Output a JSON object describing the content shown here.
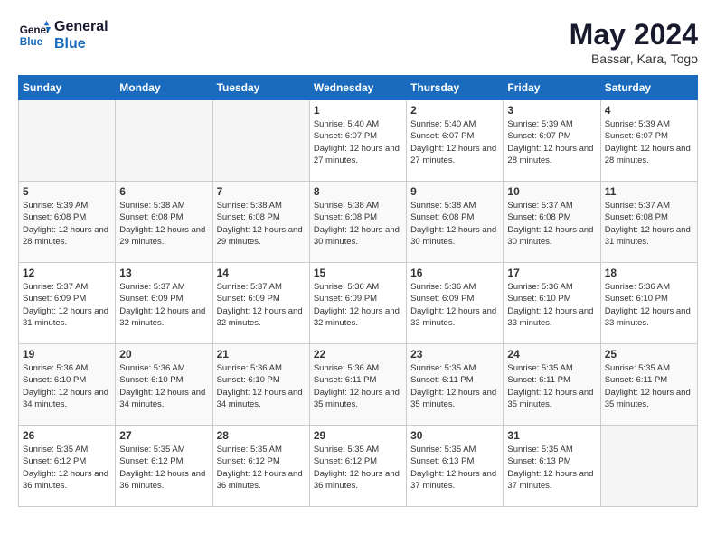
{
  "header": {
    "logo_line1": "General",
    "logo_line2": "Blue",
    "month_title": "May 2024",
    "subtitle": "Bassar, Kara, Togo"
  },
  "days_of_week": [
    "Sunday",
    "Monday",
    "Tuesday",
    "Wednesday",
    "Thursday",
    "Friday",
    "Saturday"
  ],
  "weeks": [
    [
      {
        "day": "",
        "empty": true
      },
      {
        "day": "",
        "empty": true
      },
      {
        "day": "",
        "empty": true
      },
      {
        "day": "1",
        "sunrise": "5:40 AM",
        "sunset": "6:07 PM",
        "daylight": "12 hours and 27 minutes."
      },
      {
        "day": "2",
        "sunrise": "5:40 AM",
        "sunset": "6:07 PM",
        "daylight": "12 hours and 27 minutes."
      },
      {
        "day": "3",
        "sunrise": "5:39 AM",
        "sunset": "6:07 PM",
        "daylight": "12 hours and 28 minutes."
      },
      {
        "day": "4",
        "sunrise": "5:39 AM",
        "sunset": "6:07 PM",
        "daylight": "12 hours and 28 minutes."
      }
    ],
    [
      {
        "day": "5",
        "sunrise": "5:39 AM",
        "sunset": "6:08 PM",
        "daylight": "12 hours and 28 minutes."
      },
      {
        "day": "6",
        "sunrise": "5:38 AM",
        "sunset": "6:08 PM",
        "daylight": "12 hours and 29 minutes."
      },
      {
        "day": "7",
        "sunrise": "5:38 AM",
        "sunset": "6:08 PM",
        "daylight": "12 hours and 29 minutes."
      },
      {
        "day": "8",
        "sunrise": "5:38 AM",
        "sunset": "6:08 PM",
        "daylight": "12 hours and 30 minutes."
      },
      {
        "day": "9",
        "sunrise": "5:38 AM",
        "sunset": "6:08 PM",
        "daylight": "12 hours and 30 minutes."
      },
      {
        "day": "10",
        "sunrise": "5:37 AM",
        "sunset": "6:08 PM",
        "daylight": "12 hours and 30 minutes."
      },
      {
        "day": "11",
        "sunrise": "5:37 AM",
        "sunset": "6:08 PM",
        "daylight": "12 hours and 31 minutes."
      }
    ],
    [
      {
        "day": "12",
        "sunrise": "5:37 AM",
        "sunset": "6:09 PM",
        "daylight": "12 hours and 31 minutes."
      },
      {
        "day": "13",
        "sunrise": "5:37 AM",
        "sunset": "6:09 PM",
        "daylight": "12 hours and 32 minutes."
      },
      {
        "day": "14",
        "sunrise": "5:37 AM",
        "sunset": "6:09 PM",
        "daylight": "12 hours and 32 minutes."
      },
      {
        "day": "15",
        "sunrise": "5:36 AM",
        "sunset": "6:09 PM",
        "daylight": "12 hours and 32 minutes."
      },
      {
        "day": "16",
        "sunrise": "5:36 AM",
        "sunset": "6:09 PM",
        "daylight": "12 hours and 33 minutes."
      },
      {
        "day": "17",
        "sunrise": "5:36 AM",
        "sunset": "6:10 PM",
        "daylight": "12 hours and 33 minutes."
      },
      {
        "day": "18",
        "sunrise": "5:36 AM",
        "sunset": "6:10 PM",
        "daylight": "12 hours and 33 minutes."
      }
    ],
    [
      {
        "day": "19",
        "sunrise": "5:36 AM",
        "sunset": "6:10 PM",
        "daylight": "12 hours and 34 minutes."
      },
      {
        "day": "20",
        "sunrise": "5:36 AM",
        "sunset": "6:10 PM",
        "daylight": "12 hours and 34 minutes."
      },
      {
        "day": "21",
        "sunrise": "5:36 AM",
        "sunset": "6:10 PM",
        "daylight": "12 hours and 34 minutes."
      },
      {
        "day": "22",
        "sunrise": "5:36 AM",
        "sunset": "6:11 PM",
        "daylight": "12 hours and 35 minutes."
      },
      {
        "day": "23",
        "sunrise": "5:35 AM",
        "sunset": "6:11 PM",
        "daylight": "12 hours and 35 minutes."
      },
      {
        "day": "24",
        "sunrise": "5:35 AM",
        "sunset": "6:11 PM",
        "daylight": "12 hours and 35 minutes."
      },
      {
        "day": "25",
        "sunrise": "5:35 AM",
        "sunset": "6:11 PM",
        "daylight": "12 hours and 35 minutes."
      }
    ],
    [
      {
        "day": "26",
        "sunrise": "5:35 AM",
        "sunset": "6:12 PM",
        "daylight": "12 hours and 36 minutes."
      },
      {
        "day": "27",
        "sunrise": "5:35 AM",
        "sunset": "6:12 PM",
        "daylight": "12 hours and 36 minutes."
      },
      {
        "day": "28",
        "sunrise": "5:35 AM",
        "sunset": "6:12 PM",
        "daylight": "12 hours and 36 minutes."
      },
      {
        "day": "29",
        "sunrise": "5:35 AM",
        "sunset": "6:12 PM",
        "daylight": "12 hours and 36 minutes."
      },
      {
        "day": "30",
        "sunrise": "5:35 AM",
        "sunset": "6:13 PM",
        "daylight": "12 hours and 37 minutes."
      },
      {
        "day": "31",
        "sunrise": "5:35 AM",
        "sunset": "6:13 PM",
        "daylight": "12 hours and 37 minutes."
      },
      {
        "day": "",
        "empty": true
      }
    ]
  ],
  "labels": {
    "sunrise": "Sunrise:",
    "sunset": "Sunset:",
    "daylight": "Daylight:"
  }
}
